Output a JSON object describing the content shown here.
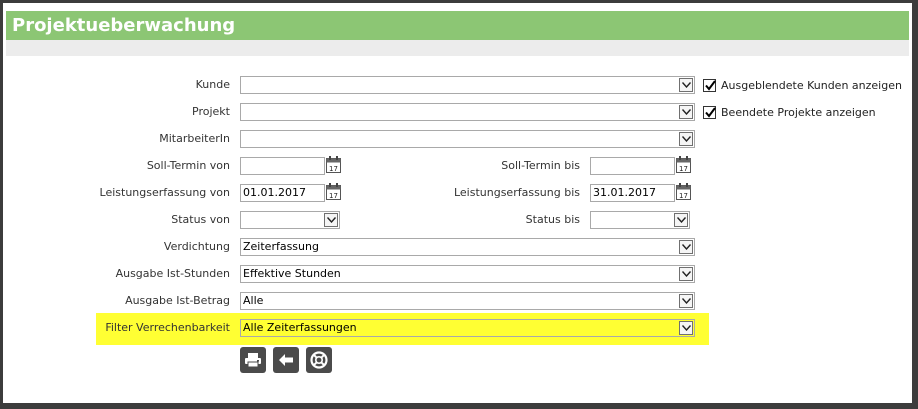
{
  "page": {
    "title": "Projektueberwachung"
  },
  "form": {
    "kunde": {
      "label": "Kunde",
      "value": ""
    },
    "projekt": {
      "label": "Projekt",
      "value": ""
    },
    "mitarbeiter": {
      "label": "MitarbeiterIn",
      "value": ""
    },
    "soll_von": {
      "label": "Soll-Termin von",
      "value": ""
    },
    "soll_bis": {
      "label": "Soll-Termin bis",
      "value": ""
    },
    "leistung_von": {
      "label": "Leistungserfassung von",
      "value": "01.01.2017"
    },
    "leistung_bis": {
      "label": "Leistungserfassung bis",
      "value": "31.01.2017"
    },
    "status_von": {
      "label": "Status von",
      "value": ""
    },
    "status_bis": {
      "label": "Status bis",
      "value": ""
    },
    "verdichtung": {
      "label": "Verdichtung",
      "value": "Zeiterfassung"
    },
    "ist_stunden": {
      "label": "Ausgabe Ist-Stunden",
      "value": "Effektive Stunden"
    },
    "ist_betrag": {
      "label": "Ausgabe Ist-Betrag",
      "value": "Alle"
    },
    "verrechenbarkeit": {
      "label": "Filter Verrechenbarkeit",
      "value": "Alle Zeiterfassungen"
    }
  },
  "options": {
    "hidden_customers": {
      "label": "Ausgeblendete Kunden anzeigen",
      "checked": true
    },
    "finished_projects": {
      "label": "Beendete Projekte anzeigen",
      "checked": true
    }
  },
  "calendar_icon_text": "17",
  "colors": {
    "title_bar": "#8cc674",
    "highlight": "#ffff33",
    "button": "#4b4b4b"
  },
  "buttons": [
    {
      "name": "print-icon"
    },
    {
      "name": "back-arrow-icon"
    },
    {
      "name": "help-lifebuoy-icon"
    }
  ]
}
